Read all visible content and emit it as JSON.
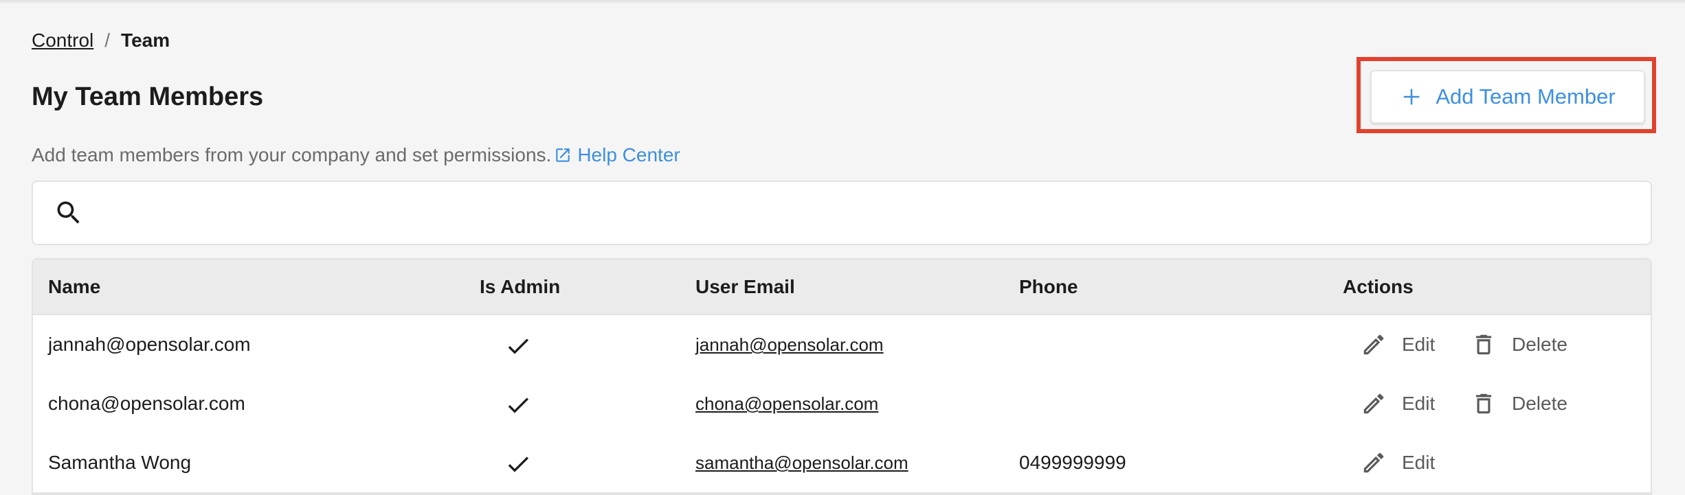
{
  "breadcrumb": {
    "parent": "Control",
    "separator": "/",
    "current": "Team"
  },
  "page": {
    "title": "My Team Members",
    "subtitle": "Add team members from your company and set permissions.",
    "help_link": "Help Center",
    "add_button": "Add Team Member"
  },
  "search": {
    "placeholder": "",
    "value": ""
  },
  "table": {
    "columns": [
      "Name",
      "Is Admin",
      "User Email",
      "Phone",
      "Actions"
    ],
    "rows": [
      {
        "name": "jannah@opensolar.com",
        "is_admin": true,
        "email": "jannah@opensolar.com",
        "phone": "",
        "edit": "Edit",
        "delete": "Delete"
      },
      {
        "name": "chona@opensolar.com",
        "is_admin": true,
        "email": "chona@opensolar.com",
        "phone": "",
        "edit": "Edit",
        "delete": "Delete"
      },
      {
        "name": "Samantha Wong",
        "is_admin": true,
        "email": "samantha@opensolar.com",
        "phone": "0499999999",
        "edit": "Edit"
      }
    ]
  },
  "colors": {
    "accent": "#3d8fe0",
    "highlight": "#e2412d",
    "background": "#f5f5f5"
  },
  "icons": {
    "search": "search-icon",
    "add": "plus-icon",
    "help": "external-link-icon",
    "check": "check-icon",
    "edit": "pencil-icon",
    "delete": "trash-icon"
  }
}
